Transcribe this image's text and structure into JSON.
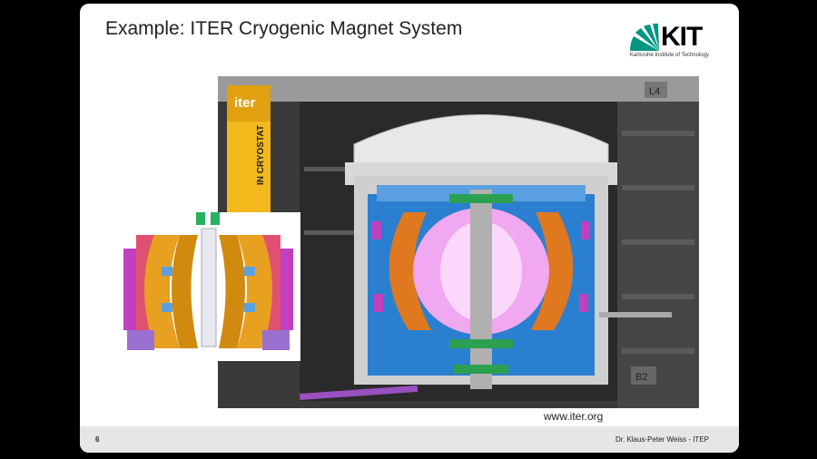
{
  "slide": {
    "title": "Example: ITER Cryogenic Magnet System",
    "url": "www.iter.org",
    "page_number": "6",
    "author": "Dr. Klaus-Peter Weiss - ITEP"
  },
  "logo": {
    "text": "KIT",
    "subtitle": "Karlsruhe Institute of Technology"
  },
  "image_labels": {
    "banner_brand": "iter",
    "banner_vertical": "IN CRYOSTAT",
    "level_top": "L4",
    "level_bottom": "B2"
  },
  "colors": {
    "slide_bg": "#ffffff",
    "kit_green": "#009682",
    "banner_yellow": "#f2b81c",
    "coil_orange": "#e07820",
    "plasma_pink": "#f0a8f0",
    "structure_blue": "#2a7fd0"
  }
}
